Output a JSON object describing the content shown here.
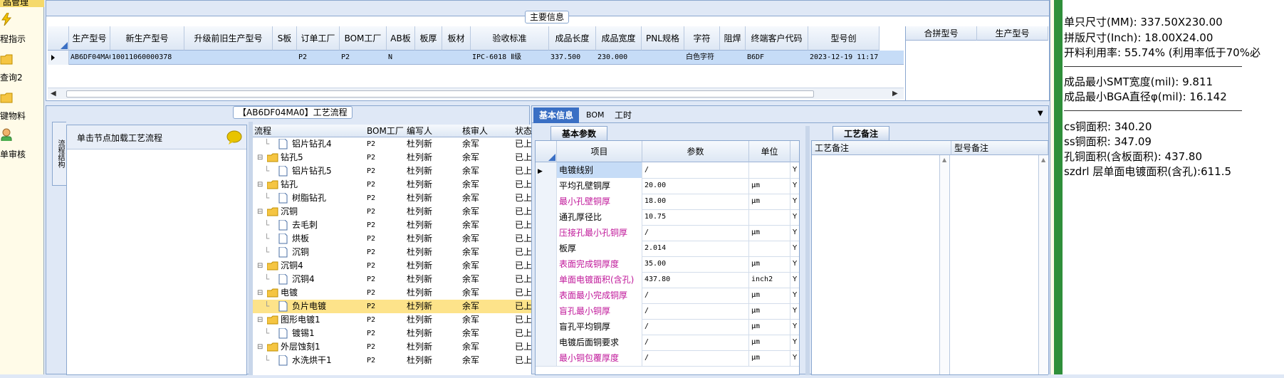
{
  "sidebar": {
    "items": [
      {
        "label": "品管理",
        "icon": "folder-icon"
      },
      {
        "label": "程指示",
        "icon": "lightning-icon"
      },
      {
        "label": "查询2",
        "icon": "folder-icon"
      },
      {
        "label": "键物料",
        "icon": "folder-icon"
      },
      {
        "label": "单审核",
        "icon": "user-icon"
      }
    ]
  },
  "main_info": {
    "title": "主要信息",
    "columns": [
      "生产型号",
      "新生产型号",
      "升级前旧生产型号",
      "S板",
      "订单工厂",
      "BOM工厂",
      "AB板",
      "板厚",
      "板材",
      "验收标准",
      "成品长度",
      "成品宽度",
      "PNL规格",
      "字符",
      "阻焊",
      "终端客户代码",
      "型号创"
    ],
    "row": [
      "AB6DF04MA0",
      "10011060000378",
      "",
      "",
      "P2",
      "P2",
      "N",
      "",
      "",
      "IPC-6018 Ⅱ级",
      "337.500",
      "230.000",
      "",
      "白色字符",
      "",
      "B6DF",
      "2023-12-19 11:17"
    ],
    "side_columns": [
      "合拼型号",
      "生产型号"
    ]
  },
  "process": {
    "title": "【AB6DF04MA0】工艺流程",
    "side_tab": "流程结构",
    "hint": "单击节点加载工艺流程",
    "columns": [
      "流程",
      "BOM工厂",
      "编写人",
      "核审人",
      "状态"
    ],
    "rows": [
      {
        "name": "铝片钻孔4",
        "bom": "P2",
        "writer": "杜列新",
        "reviewer": "余军",
        "status": "已上网",
        "level": 1,
        "type": "file"
      },
      {
        "name": "钻孔5",
        "bom": "P2",
        "writer": "杜列新",
        "reviewer": "余军",
        "status": "已上网",
        "level": 0,
        "type": "folder"
      },
      {
        "name": "铝片钻孔5",
        "bom": "P2",
        "writer": "杜列新",
        "reviewer": "余军",
        "status": "已上网",
        "level": 1,
        "type": "file"
      },
      {
        "name": "钻孔",
        "bom": "P2",
        "writer": "杜列新",
        "reviewer": "余军",
        "status": "已上网",
        "level": 0,
        "type": "folder"
      },
      {
        "name": "树脂钻孔",
        "bom": "P2",
        "writer": "杜列新",
        "reviewer": "余军",
        "status": "已上网",
        "level": 1,
        "type": "file"
      },
      {
        "name": "沉铜",
        "bom": "P2",
        "writer": "杜列新",
        "reviewer": "余军",
        "status": "已上网",
        "level": 0,
        "type": "folder"
      },
      {
        "name": "去毛刺",
        "bom": "P2",
        "writer": "杜列新",
        "reviewer": "余军",
        "status": "已上网",
        "level": 1,
        "type": "file"
      },
      {
        "name": "烘板",
        "bom": "P2",
        "writer": "杜列新",
        "reviewer": "余军",
        "status": "已上网",
        "level": 1,
        "type": "file"
      },
      {
        "name": "沉铜",
        "bom": "P2",
        "writer": "杜列新",
        "reviewer": "余军",
        "status": "已上网",
        "level": 1,
        "type": "file"
      },
      {
        "name": "沉铜4",
        "bom": "P2",
        "writer": "杜列新",
        "reviewer": "余军",
        "status": "已上网",
        "level": 0,
        "type": "folder"
      },
      {
        "name": "沉铜4",
        "bom": "P2",
        "writer": "杜列新",
        "reviewer": "余军",
        "status": "已上网",
        "level": 1,
        "type": "file"
      },
      {
        "name": "电镀",
        "bom": "P2",
        "writer": "杜列新",
        "reviewer": "余军",
        "status": "已上网",
        "level": 0,
        "type": "folder"
      },
      {
        "name": "负片电镀",
        "bom": "P2",
        "writer": "杜列新",
        "reviewer": "余军",
        "status": "已上网",
        "level": 1,
        "type": "file",
        "selected": true
      },
      {
        "name": "图形电镀1",
        "bom": "P2",
        "writer": "杜列新",
        "reviewer": "余军",
        "status": "已上网",
        "level": 0,
        "type": "folder"
      },
      {
        "name": "镀锡1",
        "bom": "P2",
        "writer": "杜列新",
        "reviewer": "余军",
        "status": "已上网",
        "level": 1,
        "type": "file"
      },
      {
        "name": "外层蚀刻1",
        "bom": "P2",
        "writer": "杜列新",
        "reviewer": "余军",
        "status": "已上网",
        "level": 0,
        "type": "folder"
      },
      {
        "name": "水洗烘干1",
        "bom": "P2",
        "writer": "杜列新",
        "reviewer": "余军",
        "status": "已上网",
        "level": 1,
        "type": "file"
      }
    ]
  },
  "basic": {
    "tabs": [
      "基本信息",
      "BOM",
      "工时"
    ],
    "param_title": "基本参数",
    "remark_title": "工艺备注",
    "columns": [
      "项目",
      "参数",
      "单位"
    ],
    "remark_columns": [
      "工艺备注",
      "型号备注"
    ],
    "rows": [
      {
        "item": "电镀线别",
        "value": "/",
        "unit": "",
        "flag": "Y",
        "pink": false
      },
      {
        "item": "平均孔壁铜厚",
        "value": "20.00",
        "unit": "μm",
        "flag": "Y",
        "pink": false
      },
      {
        "item": "最小孔壁铜厚",
        "value": "18.00",
        "unit": "μm",
        "flag": "Y",
        "pink": true
      },
      {
        "item": "通孔厚径比",
        "value": "10.75",
        "unit": "",
        "flag": "Y",
        "pink": false
      },
      {
        "item": "压接孔最小孔铜厚",
        "value": "/",
        "unit": "μm",
        "flag": "Y",
        "pink": true
      },
      {
        "item": "板厚",
        "value": "2.014",
        "unit": "",
        "flag": "Y",
        "pink": false
      },
      {
        "item": "表面完成铜厚度",
        "value": "35.00",
        "unit": "μm",
        "flag": "Y",
        "pink": true
      },
      {
        "item": "单面电镀面积(含孔)",
        "value": "437.80",
        "unit": "inch2",
        "flag": "Y",
        "pink": true
      },
      {
        "item": "表面最小完成铜厚",
        "value": "/",
        "unit": "μm",
        "flag": "Y",
        "pink": true
      },
      {
        "item": "盲孔最小铜厚",
        "value": "/",
        "unit": "μm",
        "flag": "Y",
        "pink": true
      },
      {
        "item": "盲孔平均铜厚",
        "value": "/",
        "unit": "μm",
        "flag": "Y",
        "pink": false
      },
      {
        "item": "电镀后面铜要求",
        "value": "/",
        "unit": "μm",
        "flag": "Y",
        "pink": false
      },
      {
        "item": "最小铜包覆厚度",
        "value": "/",
        "unit": "μm",
        "flag": "Y",
        "pink": true
      }
    ]
  },
  "right_info": {
    "lines": [
      "单只尺寸(MM): 337.50X230.00",
      "拼版尺寸(Inch): 18.00X24.00",
      "开料利用率: 55.74% (利用率低于70%必",
      "成品最小SMT宽度(mil): 9.811",
      "成品最小BGA直径φ(mil):   16.142",
      "cs铜面积: 340.20",
      "ss铜面积: 347.09",
      "孔铜面积(含板面积): 437.80",
      "szdrl          层单面电镀面积(含孔):611.5"
    ]
  },
  "colors": {
    "selected_row": "#c6dcf7",
    "selected_tree": "#fde38a",
    "pink_text": "#c0189a",
    "header_blue": "#3a6fc4"
  }
}
